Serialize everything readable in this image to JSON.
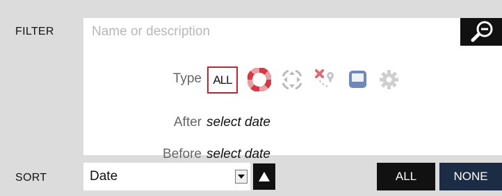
{
  "filter": {
    "label": "FILTER",
    "search": {
      "placeholder": "Name or description",
      "value": "",
      "icon": "search-icon"
    },
    "type": {
      "label": "Type",
      "all_label": "ALL",
      "selected": "ALL",
      "icons": [
        "lifebuoy-icon",
        "crosshair-icon",
        "route-marker-icon",
        "window-icon",
        "gear-icon"
      ]
    },
    "after": {
      "label": "After",
      "value": "select date"
    },
    "before": {
      "label": "Before",
      "value": "select date"
    }
  },
  "sort": {
    "label": "SORT",
    "selected": "Date",
    "direction": "ascending",
    "all_label": "ALL",
    "none_label": "NONE"
  },
  "colors": {
    "accent_red": "#c8202f",
    "button_dark": "#111111",
    "button_navy": "#1b2c44",
    "icon_gray": "#c4c4c4"
  }
}
